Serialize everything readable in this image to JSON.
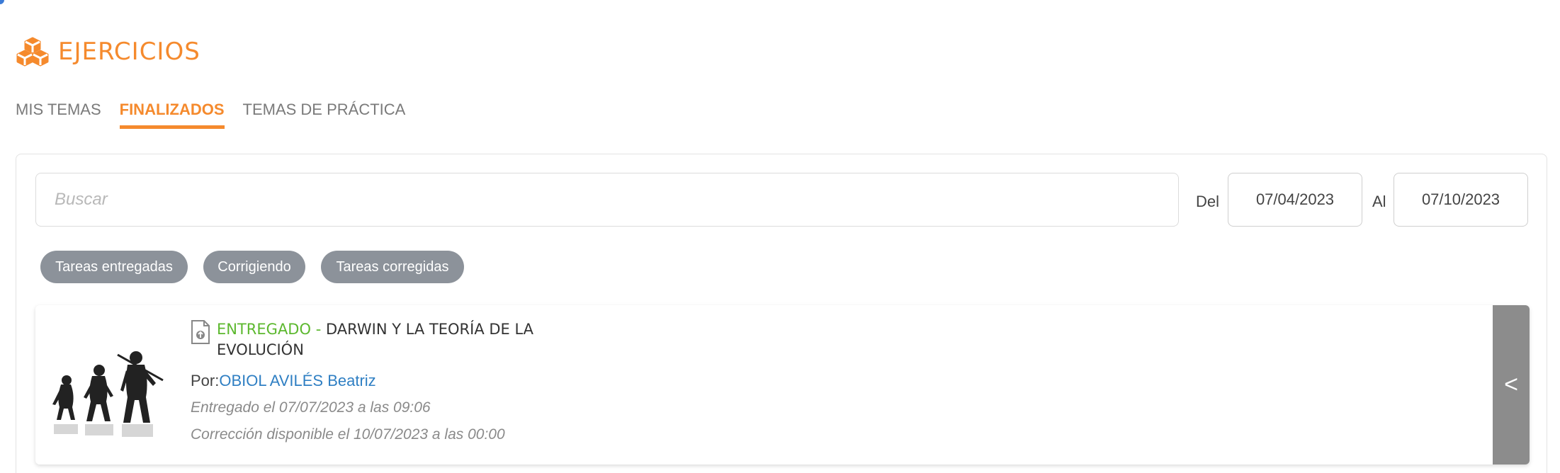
{
  "header": {
    "title": "EJERCICIOS",
    "icon": "cubes-icon",
    "accent_color": "#f58a2d"
  },
  "tabs": [
    {
      "label": "MIS TEMAS",
      "active": false
    },
    {
      "label": "FINALIZADOS",
      "active": true
    },
    {
      "label": "TEMAS DE PRÁCTICA",
      "active": false
    }
  ],
  "filters": {
    "search_placeholder": "Buscar",
    "from_label": "Del",
    "from_date": "07/04/2023",
    "to_label": "Al",
    "to_date": "07/10/2023"
  },
  "chips": [
    {
      "label": "Tareas entregadas"
    },
    {
      "label": "Corrigiendo"
    },
    {
      "label": "Tareas corregidas"
    }
  ],
  "card": {
    "status": "ENTREGADO",
    "separator": " - ",
    "title": "DARWIN Y LA TEORÍA DE LA EVOLUCIÓN",
    "by_label": "Por:",
    "author": "OBIOL AVILÉS Beatriz",
    "delivered": "Entregado el 07/07/2023 a las 09:06",
    "correction": "Corrección disponible el 10/07/2023 a las 00:00",
    "toggle": "<",
    "status_color": "#5cb82e",
    "author_color": "#2f7fc3"
  }
}
